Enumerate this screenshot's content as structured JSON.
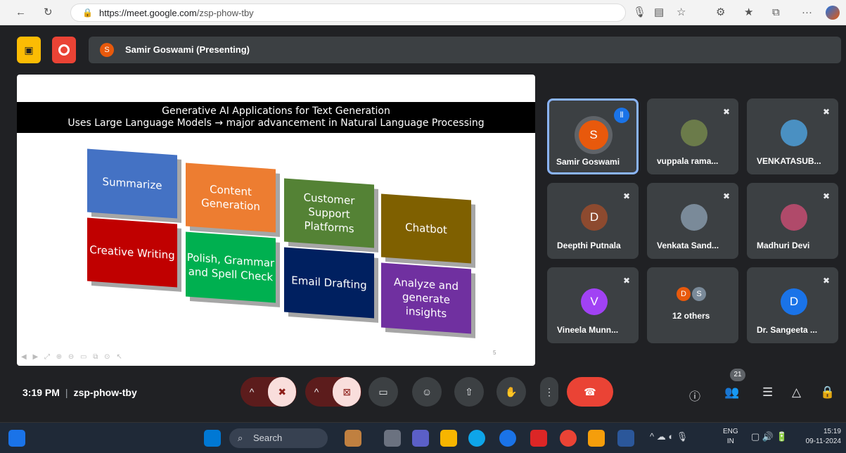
{
  "browser": {
    "url_domain": "https://meet.google.com",
    "url_path": "/zsp-phow-tby"
  },
  "presenter": {
    "initial": "S",
    "label": "Samir Goswami (Presenting)"
  },
  "slide": {
    "title": "Generative AI Applications for Text Generation",
    "subtitle": "Uses Large Language Models → major advancement in Natural Language Processing",
    "page_number": "5",
    "boxes": [
      {
        "label": "Summarize",
        "color": "#4472c4"
      },
      {
        "label": "Content Generation",
        "color": "#ed7d31"
      },
      {
        "label": "Customer Support Platforms",
        "color": "#548235"
      },
      {
        "label": "Chatbot",
        "color": "#7f6000"
      },
      {
        "label": "Creative Writing",
        "color": "#c00000"
      },
      {
        "label": "Polish, Grammar and Spell Check",
        "color": "#00b050"
      },
      {
        "label": "Email Drafting",
        "color": "#002060"
      },
      {
        "label": "Analyze and generate insights",
        "color": "#7030a0"
      }
    ]
  },
  "participants": [
    {
      "name": "Samir Goswami",
      "initial": "S",
      "color": "#e8590c"
    },
    {
      "name": "vuppala rama...",
      "initial": "",
      "color": "#6b7b4a"
    },
    {
      "name": "VENKATASUB...",
      "initial": "",
      "color": "#4a90c2"
    },
    {
      "name": "Deepthi Putnala",
      "initial": "D",
      "color": "#8d4a2f"
    },
    {
      "name": "Venkata Sand...",
      "initial": "",
      "color": "#7a8a99"
    },
    {
      "name": "Madhuri Devi",
      "initial": "",
      "color": "#b04a6a"
    },
    {
      "name": "Vineela Munn...",
      "initial": "V",
      "color": "#a142f4"
    },
    {
      "name": "12 others",
      "initial": "",
      "color": "#3c4043"
    },
    {
      "name": "Dr. Sangeeta ...",
      "initial": "D",
      "color": "#1a73e8"
    }
  ],
  "others_initials": [
    "D",
    "S"
  ],
  "bottom": {
    "time": "3:19 PM",
    "meeting_code": "zsp-phow-tby",
    "people_count": "21"
  },
  "taskbar": {
    "search": "Search",
    "lang": "ENG",
    "region": "IN",
    "clock_time": "15:19",
    "clock_date": "09-11-2024"
  }
}
